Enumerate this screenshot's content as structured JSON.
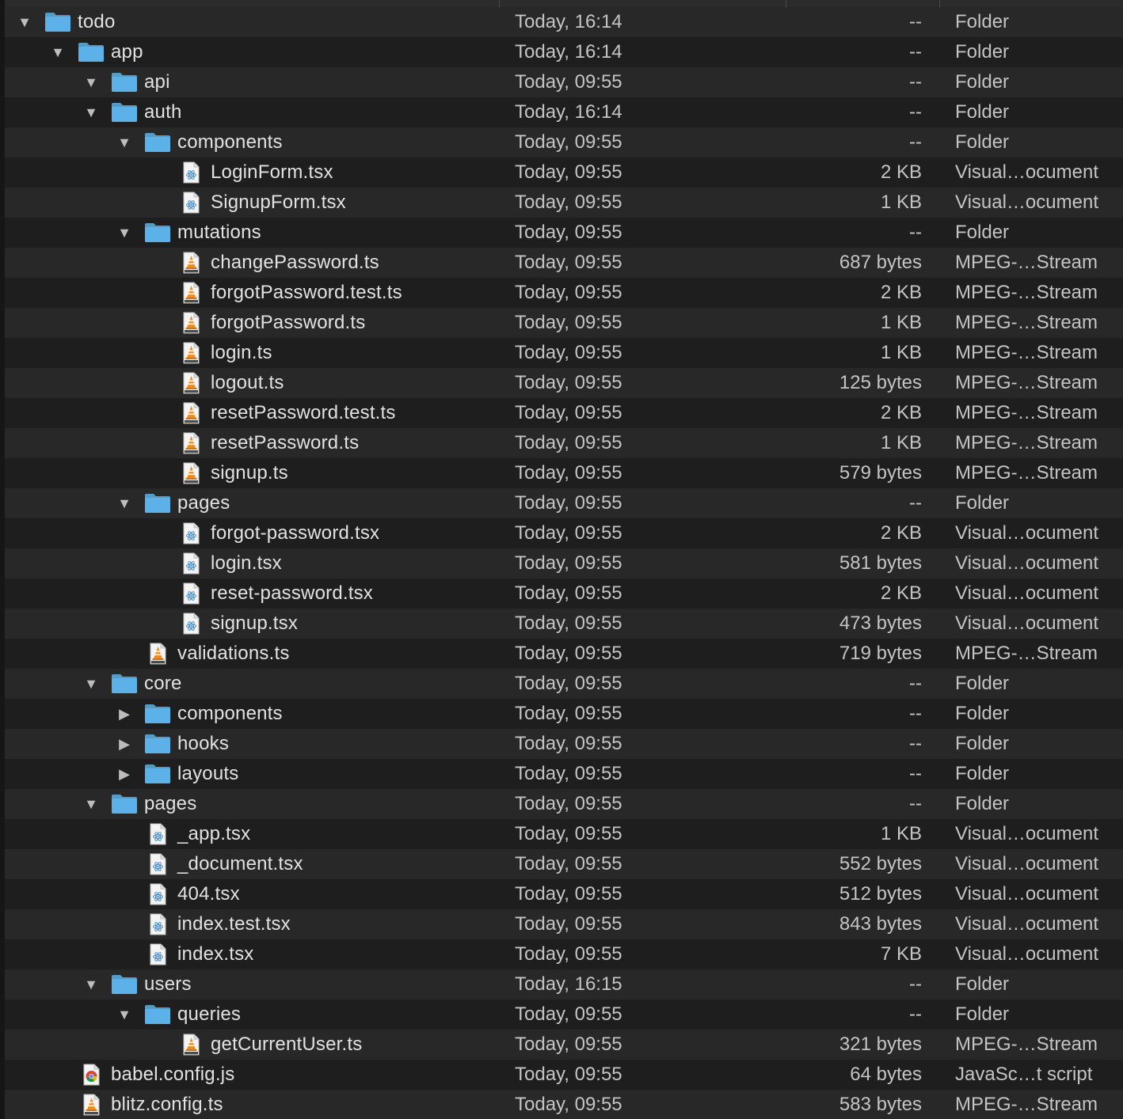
{
  "colors": {
    "background": "#1e1e1e",
    "row_alt": "#282828",
    "folder": "#5bb1e8",
    "text": "#e2e2e2"
  },
  "rows": [
    {
      "name": "todo",
      "date": "Today, 16:14",
      "size": "--",
      "kind": "Folder",
      "icon": "folder-icon",
      "depth": 0,
      "toggle": "expanded"
    },
    {
      "name": "app",
      "date": "Today, 16:14",
      "size": "--",
      "kind": "Folder",
      "icon": "folder-icon",
      "depth": 1,
      "toggle": "expanded"
    },
    {
      "name": "api",
      "date": "Today, 09:55",
      "size": "--",
      "kind": "Folder",
      "icon": "folder-icon",
      "depth": 2,
      "toggle": "expanded"
    },
    {
      "name": "auth",
      "date": "Today, 16:14",
      "size": "--",
      "kind": "Folder",
      "icon": "folder-icon",
      "depth": 2,
      "toggle": "expanded"
    },
    {
      "name": "components",
      "date": "Today, 09:55",
      "size": "--",
      "kind": "Folder",
      "icon": "folder-icon",
      "depth": 3,
      "toggle": "expanded"
    },
    {
      "name": "LoginForm.tsx",
      "date": "Today, 09:55",
      "size": "2 KB",
      "kind": "Visual…ocument",
      "icon": "react-file-icon",
      "depth": 4,
      "toggle": "none"
    },
    {
      "name": "SignupForm.tsx",
      "date": "Today, 09:55",
      "size": "1 KB",
      "kind": "Visual…ocument",
      "icon": "react-file-icon",
      "depth": 4,
      "toggle": "none"
    },
    {
      "name": "mutations",
      "date": "Today, 09:55",
      "size": "--",
      "kind": "Folder",
      "icon": "folder-icon",
      "depth": 3,
      "toggle": "expanded"
    },
    {
      "name": "changePassword.ts",
      "date": "Today, 09:55",
      "size": "687 bytes",
      "kind": "MPEG-…Stream",
      "icon": "mpeg-file-icon",
      "depth": 4,
      "toggle": "none"
    },
    {
      "name": "forgotPassword.test.ts",
      "date": "Today, 09:55",
      "size": "2 KB",
      "kind": "MPEG-…Stream",
      "icon": "mpeg-file-icon",
      "depth": 4,
      "toggle": "none"
    },
    {
      "name": "forgotPassword.ts",
      "date": "Today, 09:55",
      "size": "1 KB",
      "kind": "MPEG-…Stream",
      "icon": "mpeg-file-icon",
      "depth": 4,
      "toggle": "none"
    },
    {
      "name": "login.ts",
      "date": "Today, 09:55",
      "size": "1 KB",
      "kind": "MPEG-…Stream",
      "icon": "mpeg-file-icon",
      "depth": 4,
      "toggle": "none"
    },
    {
      "name": "logout.ts",
      "date": "Today, 09:55",
      "size": "125 bytes",
      "kind": "MPEG-…Stream",
      "icon": "mpeg-file-icon",
      "depth": 4,
      "toggle": "none"
    },
    {
      "name": "resetPassword.test.ts",
      "date": "Today, 09:55",
      "size": "2 KB",
      "kind": "MPEG-…Stream",
      "icon": "mpeg-file-icon",
      "depth": 4,
      "toggle": "none"
    },
    {
      "name": "resetPassword.ts",
      "date": "Today, 09:55",
      "size": "1 KB",
      "kind": "MPEG-…Stream",
      "icon": "mpeg-file-icon",
      "depth": 4,
      "toggle": "none"
    },
    {
      "name": "signup.ts",
      "date": "Today, 09:55",
      "size": "579 bytes",
      "kind": "MPEG-…Stream",
      "icon": "mpeg-file-icon",
      "depth": 4,
      "toggle": "none"
    },
    {
      "name": "pages",
      "date": "Today, 09:55",
      "size": "--",
      "kind": "Folder",
      "icon": "folder-icon",
      "depth": 3,
      "toggle": "expanded"
    },
    {
      "name": "forgot-password.tsx",
      "date": "Today, 09:55",
      "size": "2 KB",
      "kind": "Visual…ocument",
      "icon": "react-file-icon",
      "depth": 4,
      "toggle": "none"
    },
    {
      "name": "login.tsx",
      "date": "Today, 09:55",
      "size": "581 bytes",
      "kind": "Visual…ocument",
      "icon": "react-file-icon",
      "depth": 4,
      "toggle": "none"
    },
    {
      "name": "reset-password.tsx",
      "date": "Today, 09:55",
      "size": "2 KB",
      "kind": "Visual…ocument",
      "icon": "react-file-icon",
      "depth": 4,
      "toggle": "none"
    },
    {
      "name": "signup.tsx",
      "date": "Today, 09:55",
      "size": "473 bytes",
      "kind": "Visual…ocument",
      "icon": "react-file-icon",
      "depth": 4,
      "toggle": "none"
    },
    {
      "name": "validations.ts",
      "date": "Today, 09:55",
      "size": "719 bytes",
      "kind": "MPEG-…Stream",
      "icon": "mpeg-file-icon",
      "depth": 3,
      "toggle": "none"
    },
    {
      "name": "core",
      "date": "Today, 09:55",
      "size": "--",
      "kind": "Folder",
      "icon": "folder-icon",
      "depth": 2,
      "toggle": "expanded"
    },
    {
      "name": "components",
      "date": "Today, 09:55",
      "size": "--",
      "kind": "Folder",
      "icon": "folder-icon",
      "depth": 3,
      "toggle": "collapsed"
    },
    {
      "name": "hooks",
      "date": "Today, 09:55",
      "size": "--",
      "kind": "Folder",
      "icon": "folder-icon",
      "depth": 3,
      "toggle": "collapsed"
    },
    {
      "name": "layouts",
      "date": "Today, 09:55",
      "size": "--",
      "kind": "Folder",
      "icon": "folder-icon",
      "depth": 3,
      "toggle": "collapsed"
    },
    {
      "name": "pages",
      "date": "Today, 09:55",
      "size": "--",
      "kind": "Folder",
      "icon": "folder-icon",
      "depth": 2,
      "toggle": "expanded"
    },
    {
      "name": "_app.tsx",
      "date": "Today, 09:55",
      "size": "1 KB",
      "kind": "Visual…ocument",
      "icon": "react-file-icon",
      "depth": 3,
      "toggle": "none"
    },
    {
      "name": "_document.tsx",
      "date": "Today, 09:55",
      "size": "552 bytes",
      "kind": "Visual…ocument",
      "icon": "react-file-icon",
      "depth": 3,
      "toggle": "none"
    },
    {
      "name": "404.tsx",
      "date": "Today, 09:55",
      "size": "512 bytes",
      "kind": "Visual…ocument",
      "icon": "react-file-icon",
      "depth": 3,
      "toggle": "none"
    },
    {
      "name": "index.test.tsx",
      "date": "Today, 09:55",
      "size": "843 bytes",
      "kind": "Visual…ocument",
      "icon": "react-file-icon",
      "depth": 3,
      "toggle": "none"
    },
    {
      "name": "index.tsx",
      "date": "Today, 09:55",
      "size": "7 KB",
      "kind": "Visual…ocument",
      "icon": "react-file-icon",
      "depth": 3,
      "toggle": "none"
    },
    {
      "name": "users",
      "date": "Today, 16:15",
      "size": "--",
      "kind": "Folder",
      "icon": "folder-icon",
      "depth": 2,
      "toggle": "expanded"
    },
    {
      "name": "queries",
      "date": "Today, 09:55",
      "size": "--",
      "kind": "Folder",
      "icon": "folder-icon",
      "depth": 3,
      "toggle": "expanded"
    },
    {
      "name": "getCurrentUser.ts",
      "date": "Today, 09:55",
      "size": "321 bytes",
      "kind": "MPEG-…Stream",
      "icon": "mpeg-file-icon",
      "depth": 4,
      "toggle": "none"
    },
    {
      "name": "babel.config.js",
      "date": "Today, 09:55",
      "size": "64 bytes",
      "kind": "JavaSc…t script",
      "icon": "chrome-file-icon",
      "depth": 1,
      "toggle": "none"
    },
    {
      "name": "blitz.config.ts",
      "date": "Today, 09:55",
      "size": "583 bytes",
      "kind": "MPEG-…Stream",
      "icon": "mpeg-file-icon",
      "depth": 1,
      "toggle": "none"
    }
  ]
}
